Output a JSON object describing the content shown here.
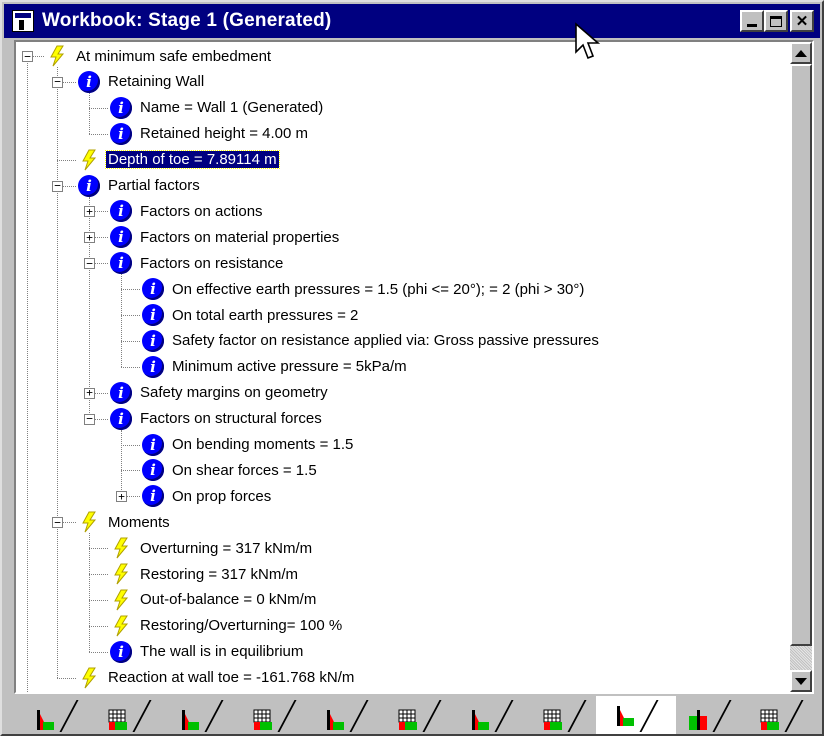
{
  "window": {
    "title": "Workbook: Stage 1 (Generated)",
    "icon": "workbook-icon",
    "controls": [
      "minimize-icon",
      "maximize-icon",
      "close-icon"
    ]
  },
  "tree": {
    "nodes": [
      {
        "label": "At minimum safe embedment",
        "icon": "lightning-icon",
        "expander": "minus"
      },
      {
        "label": "Retaining Wall",
        "icon": "info-icon",
        "expander": "minus"
      },
      {
        "label": "Name = Wall 1 (Generated)",
        "icon": "info-icon"
      },
      {
        "label": "Retained height = 4.00 m",
        "icon": "info-icon"
      },
      {
        "label": "Depth of toe = 7.89114 m",
        "icon": "lightning-icon",
        "selected": true
      },
      {
        "label": "Partial factors",
        "icon": "info-icon",
        "expander": "minus"
      },
      {
        "label": "Factors on actions",
        "icon": "info-icon",
        "expander": "plus"
      },
      {
        "label": "Factors on material properties",
        "icon": "info-icon",
        "expander": "plus"
      },
      {
        "label": "Factors on resistance",
        "icon": "info-icon",
        "expander": "minus"
      },
      {
        "label": "On effective earth pressures = 1.5 (phi <= 20°); = 2 (phi > 30°)",
        "icon": "info-icon"
      },
      {
        "label": "On total earth pressures = 2",
        "icon": "info-icon"
      },
      {
        "label": "Safety factor on resistance applied via: Gross passive pressures",
        "icon": "info-icon"
      },
      {
        "label": "Minimum active pressure = 5kPa/m",
        "icon": "info-icon"
      },
      {
        "label": "Safety margins on geometry",
        "icon": "info-icon",
        "expander": "plus"
      },
      {
        "label": "Factors on structural forces",
        "icon": "info-icon",
        "expander": "minus"
      },
      {
        "label": "On bending moments = 1.5",
        "icon": "info-icon"
      },
      {
        "label": "On shear forces = 1.5",
        "icon": "info-icon"
      },
      {
        "label": "On prop forces",
        "icon": "info-icon",
        "expander": "plus"
      },
      {
        "label": "Moments",
        "icon": "lightning-icon",
        "expander": "minus"
      },
      {
        "label": "Overturning = 317 kNm/m",
        "icon": "lightning-icon"
      },
      {
        "label": "Restoring = 317 kNm/m",
        "icon": "lightning-icon"
      },
      {
        "label": "Out-of-balance = 0 kNm/m",
        "icon": "lightning-icon"
      },
      {
        "label": "Restoring/Overturning= 100 %",
        "icon": "lightning-icon"
      },
      {
        "label": "The wall is in equilibrium",
        "icon": "info-icon"
      },
      {
        "label": "Reaction at wall toe = -161.768 kN/m",
        "icon": "lightning-icon"
      }
    ]
  },
  "tabs": [
    {
      "icon": "wall-diagram-icon"
    },
    {
      "icon": "grid-diagram-icon"
    },
    {
      "icon": "wall-diagram-icon"
    },
    {
      "icon": "grid-diagram-icon"
    },
    {
      "icon": "wall-diagram-icon"
    },
    {
      "icon": "grid-diagram-icon"
    },
    {
      "icon": "wall-diagram-icon"
    },
    {
      "icon": "grid-diagram-icon"
    },
    {
      "icon": "wall-diagram-icon",
      "active": true
    },
    {
      "icon": "split-diagram-icon"
    },
    {
      "icon": "grid-diagram-icon"
    }
  ],
  "colors": {
    "titlebar": "#000080",
    "info_icon": "#0000ff",
    "lightning": "#ffff00",
    "selection": "#000080"
  }
}
